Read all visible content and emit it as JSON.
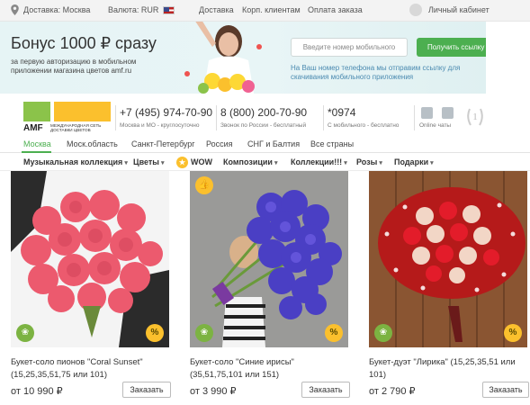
{
  "topbar": {
    "delivery": "Доставка: Москва",
    "currency": "Валюта: RUR",
    "links": [
      "Доставка",
      "Корп. клиентам",
      "Оплата заказа"
    ],
    "cabinet": "Личный кабинет"
  },
  "banner": {
    "title": "Бонус 1000 ₽ сразу",
    "subtitle": "за первую авторизацию в мобильном приложении магазина цветов amf.ru",
    "phone_placeholder": "Введите номер мобильного",
    "button": "Получить ссылку",
    "note": "На Ваш номер телефона мы отправим ссылку для скачивания мобильного приложения"
  },
  "header": {
    "logo_text": "AMF",
    "logo_tagline": "МЕЖДУНАРОДНАЯ СЕТЬ ДОСТАВКИ ЦВЕТОВ",
    "phones": [
      {
        "number": "+7 (495) 974-70-90",
        "sub": "Москва и МО - круглосуточно"
      },
      {
        "number": "8 (800) 200-70-90",
        "sub": "Звонок по России - бесплатный"
      },
      {
        "number": "*0974",
        "sub": "С мобильного - бесплатно"
      }
    ],
    "online": "Online чаты"
  },
  "cities": [
    "Москва",
    "Моск.область",
    "Санкт-Петербург",
    "Россия",
    "СНГ и Балтия",
    "Все страны"
  ],
  "categories": [
    "Музыкальная коллекция",
    "Цветы",
    "WOW",
    "Композиции",
    "Коллекции!!!",
    "Розы",
    "Подарки"
  ],
  "products": [
    {
      "title": "Букет-соло пионов \"Coral Sunset\" (15,25,35,51,75 или 101)",
      "price": "от 10 990 ₽",
      "button": "Заказать"
    },
    {
      "title": "Букет-соло \"Синие ирисы\" (35,51,75,101 или 151)",
      "price": "от 3 990 ₽",
      "button": "Заказать"
    },
    {
      "title": "Букет-дуэт \"Лирика\" (15,25,35,51 или 101)",
      "price": "от 2 790 ₽",
      "button": "Заказать"
    }
  ],
  "colors": {
    "accent": "#4caf50",
    "brand_yellow": "#fbc02d",
    "brand_green": "#8bc34a"
  }
}
